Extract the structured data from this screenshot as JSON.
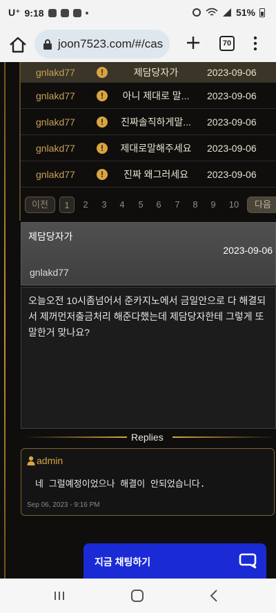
{
  "status_bar": {
    "carrier": "U⁺",
    "time": "9:18",
    "battery": "51%"
  },
  "browser": {
    "url": "joon7523.com/#/cas",
    "tab_count": "70"
  },
  "posts_table": {
    "rows": [
      {
        "author": "gnlakd77",
        "title": "제담당자가",
        "date": "2023-09-06"
      },
      {
        "author": "gnlakd77",
        "title": "아니 제대로 말...",
        "date": "2023-09-06"
      },
      {
        "author": "gnlakd77",
        "title": "진짜솔직하게말...",
        "date": "2023-09-06"
      },
      {
        "author": "gnlakd77",
        "title": "제대로말해주세요",
        "date": "2023-09-06"
      },
      {
        "author": "gnlakd77",
        "title": "진짜 왜그러세요",
        "date": "2023-09-06"
      }
    ],
    "warn_symbol": "!"
  },
  "pagination": {
    "prev_label": "이전",
    "next_label": "다음",
    "pages": [
      "1",
      "2",
      "3",
      "4",
      "5",
      "6",
      "7",
      "8",
      "9",
      "10"
    ],
    "current": "1"
  },
  "post": {
    "title": "제담당자가",
    "date": "2023-09-06",
    "author": "gnlakd77",
    "body": "오늘오전 10시좀넘어서 준카지노에서 금일안으로 다 해결되서 제꺼먼저출금처리 해준다했는데 제담당자한테 그렇게 또 말한거 맞나요?"
  },
  "replies": {
    "label": "Replies",
    "items": [
      {
        "user": "admin",
        "text": "네 그럴예정이었으나 해결이 안되었습니다.",
        "time": "Sep 06, 2023 - 9:16 PM"
      }
    ]
  },
  "chat": {
    "label": "지금 채팅하기"
  },
  "colors": {
    "gold": "#d9a441",
    "page_bg": "#0f0e0c",
    "chat_blue": "#1a2bd6"
  }
}
